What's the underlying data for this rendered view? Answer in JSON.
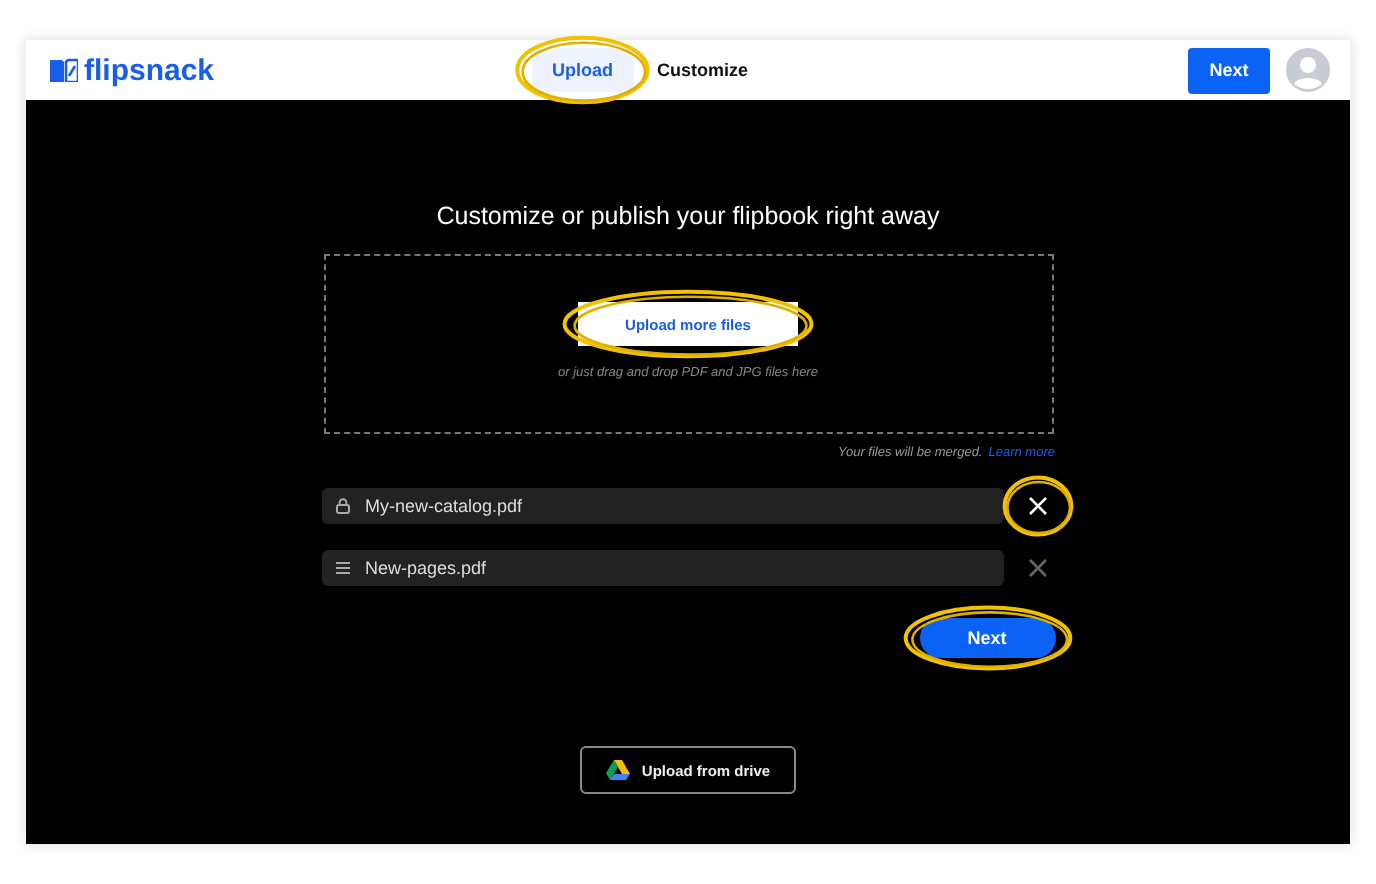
{
  "header": {
    "logo": "flipsnack",
    "tabs": [
      {
        "label": "Upload",
        "selected": true,
        "highlighted": true
      },
      {
        "label": "Customize",
        "selected": false,
        "highlighted": false
      }
    ],
    "next_button": "Next"
  },
  "main": {
    "title": "Customize or publish your flipbook right away",
    "dropzone": {
      "button": "Upload more files",
      "button_highlighted": true,
      "hint": "or just drag and drop PDF and JPG files here"
    },
    "merge_note": "Your files will be merged.",
    "learn_more": "Learn more",
    "files": [
      {
        "name": "My-new-catalog.pdf",
        "kind": "locked",
        "remove_highlighted": true
      },
      {
        "name": "New-pages.pdf",
        "kind": "draggable",
        "remove_highlighted": false
      }
    ],
    "next_button": {
      "label": "Next",
      "highlighted": true
    },
    "drive_button": "Upload from drive"
  }
}
